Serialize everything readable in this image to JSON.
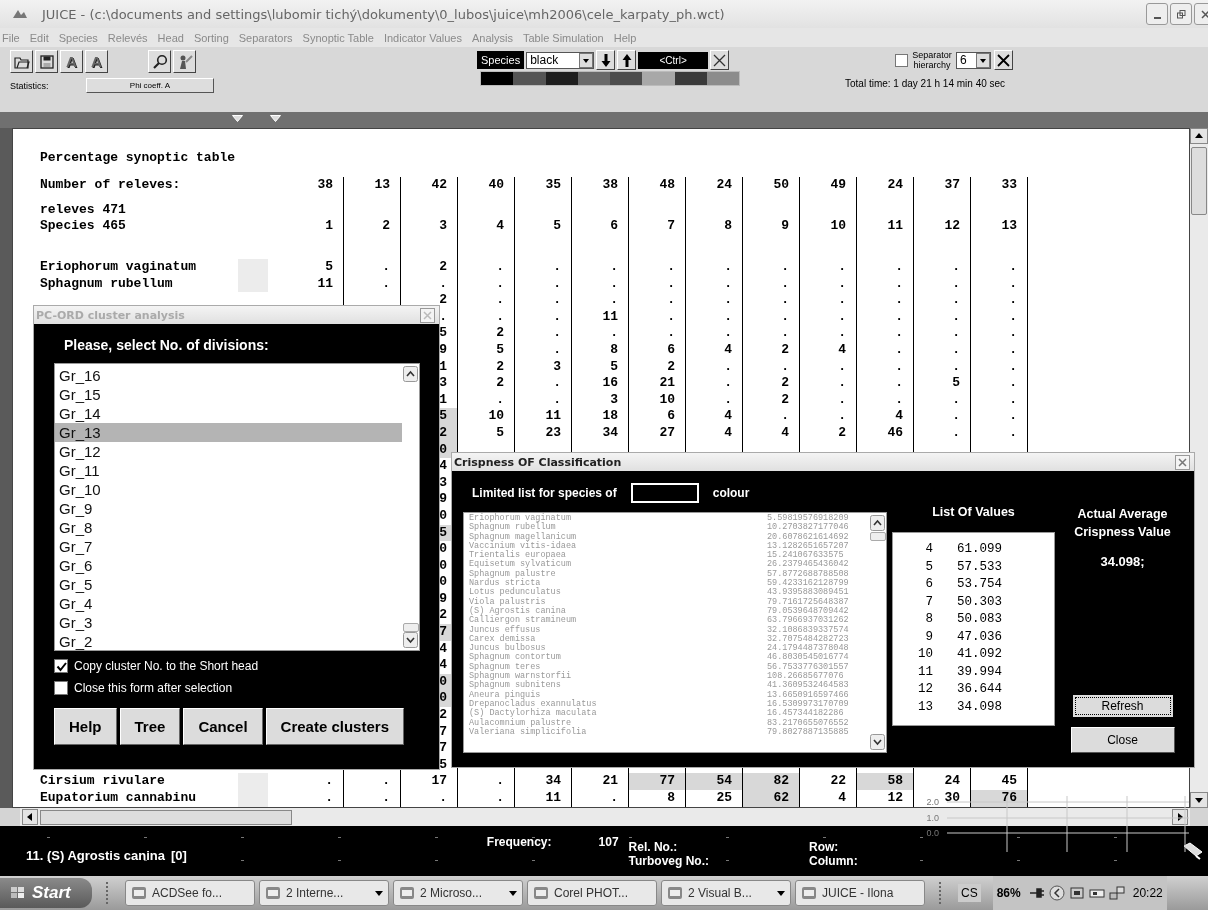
{
  "window": {
    "title": "JUICE - (c:\\documents and settings\\lubomir tichý\\dokumenty\\0_lubos\\juice\\mh2006\\cele_karpaty_ph.wct)"
  },
  "menu": [
    "File",
    "Edit",
    "Species",
    "Relevés",
    "Head",
    "Sorting",
    "Separators",
    "Synoptic Table",
    "Indicator Values",
    "Analysis",
    "Table Simulation",
    "Help"
  ],
  "toolbar": {
    "font_buttons": [
      "A",
      "A"
    ],
    "statistics_label": "Statistics:",
    "statistics_button": "Phi coeff. A",
    "species_label": "Species",
    "species_color": "black",
    "ctrl_label": "<Ctrl>",
    "swatches": [
      {
        "color": "#000000"
      },
      {
        "color": "#555555"
      },
      {
        "color": "#1e1e1e"
      },
      {
        "color": "#6a6a6a"
      },
      {
        "color": "#4c4c4c"
      },
      {
        "color": "#a8a8a8"
      },
      {
        "color": "#3a3a3a"
      },
      {
        "color": "#8c8c8c"
      }
    ],
    "separator_hierarchy": {
      "label": "Separator hierarchy",
      "checked": false,
      "value": "6"
    },
    "total_time": "Total time: 1 day 21 h 14 min 40 sec"
  },
  "table": {
    "title": "Percentage synoptic table",
    "count_label": "Number of releves:",
    "counts": [
      "38",
      "13",
      "42",
      "40",
      "35",
      "38",
      "48",
      "24",
      "50",
      "49",
      "24",
      "37",
      "33"
    ],
    "releves_label": "releves 471",
    "species_label": "Species 465",
    "columns": [
      "1",
      "2",
      "3",
      "4",
      "5",
      "6",
      "7",
      "8",
      "9",
      "10",
      "11",
      "12",
      "13"
    ],
    "rows": [
      {
        "name": "Eriophorum vaginatum",
        "values": {
          "column_1": "5",
          "column_2": ".",
          "column_3": "2",
          "column_4": ".",
          "column_5": ".",
          "column_6": ".",
          "column_7": ".",
          "column_8": ".",
          "column_9": ".",
          "column_10": ".",
          "column_11": ".",
          "column_12": ".",
          "column_13": "."
        }
      },
      {
        "name": "Sphagnum rubellum",
        "values": {
          "column_1": "11",
          "column_2": ".",
          "column_3": ".",
          "column_4": ".",
          "column_5": ".",
          "column_6": ".",
          "column_7": ".",
          "column_8": ".",
          "column_9": ".",
          "column_10": ".",
          "column_11": ".",
          "column_12": ".",
          "column_13": "."
        }
      },
      {
        "values": {
          "column_3": "2",
          "column_4": ".",
          "column_5": ".",
          "column_6": ".",
          "column_7": ".",
          "column_8": ".",
          "column_9": ".",
          "column_10": ".",
          "column_11": ".",
          "column_12": ".",
          "column_13": "."
        }
      },
      {
        "values": {
          "column_3": ".",
          "column_4": ".",
          "column_5": ".",
          "column_6": "11",
          "column_7": ".",
          "column_8": ".",
          "column_9": ".",
          "column_10": ".",
          "column_11": ".",
          "column_12": ".",
          "column_13": "."
        }
      },
      {
        "values": {
          "column_3": "5",
          "column_4": "2",
          "column_5": ".",
          "column_6": ".",
          "column_7": ".",
          "column_8": ".",
          "column_9": ".",
          "column_10": ".",
          "column_11": ".",
          "column_12": ".",
          "column_13": "."
        }
      },
      {
        "values": {
          "column_3": "9",
          "column_4": "5",
          "column_5": ".",
          "column_6": "8",
          "column_7": "6",
          "column_8": "4",
          "column_9": "2",
          "column_10": "4",
          "column_11": ".",
          "column_12": ".",
          "column_13": "."
        }
      },
      {
        "values": {
          "column_3": "1",
          "column_4": "2",
          "column_5": "3",
          "column_6": "5",
          "column_7": "2",
          "column_8": ".",
          "column_9": ".",
          "column_10": ".",
          "column_11": ".",
          "column_12": ".",
          "column_13": "."
        }
      },
      {
        "values": {
          "column_3": "3",
          "column_4": "2",
          "column_5": ".",
          "column_6": "16",
          "column_7": "21",
          "column_8": ".",
          "column_9": "2",
          "column_10": ".",
          "column_11": ".",
          "column_12": "5",
          "column_13": "."
        }
      },
      {
        "values": {
          "column_3": "1",
          "column_4": ".",
          "column_5": ".",
          "column_6": "3",
          "column_7": "10",
          "column_8": ".",
          "column_9": "2",
          "column_10": ".",
          "column_11": ".",
          "column_12": ".",
          "column_13": "."
        }
      },
      {
        "values": {
          "column_3": {
            "text": "5",
            "highlighted": true
          },
          "column_4": "10",
          "column_5": "11",
          "column_6": "18",
          "column_7": "6",
          "column_8": "4",
          "column_9": ".",
          "column_10": ".",
          "column_11": "4",
          "column_12": ".",
          "column_13": "."
        }
      },
      {
        "values": {
          "column_3": {
            "text": "2",
            "highlighted": true
          },
          "column_4": "5",
          "column_5": "23",
          "column_6": "34",
          "column_7": "27",
          "column_8": "4",
          "column_9": "4",
          "column_10": "2",
          "column_11": "46",
          "column_12": ".",
          "column_13": "."
        }
      },
      {
        "values": {
          "column_3": {
            "text": "0",
            "highlighted": true
          }
        }
      },
      {
        "values": {
          "column_3": "4"
        }
      },
      {
        "values": {
          "column_3": "3"
        }
      },
      {
        "values": {
          "column_3": "9"
        }
      },
      {
        "values": {
          "column_3": "0"
        }
      },
      {
        "values": {
          "column_3": {
            "text": "5",
            "highlighted": true
          }
        }
      },
      {
        "values": {
          "column_3": "0"
        }
      },
      {
        "values": {
          "column_3": "0"
        }
      },
      {
        "values": {
          "column_3": "0"
        }
      },
      {
        "values": {
          "column_3": "9"
        }
      },
      {
        "values": {
          "column_3": "2"
        }
      },
      {
        "values": {
          "column_3": {
            "text": "7",
            "highlighted": true
          }
        }
      },
      {
        "values": {
          "column_3": "4"
        }
      },
      {
        "values": {
          "column_3": "4"
        }
      },
      {
        "values": {
          "column_3": {
            "text": "0",
            "highlighted": true
          }
        }
      },
      {
        "values": {
          "column_3": {
            "text": "0",
            "highlighted": true
          }
        }
      },
      {
        "values": {
          "column_3": "2"
        }
      },
      {
        "values": {
          "column_3": "7"
        }
      },
      {
        "values": {
          "column_3": "7"
        }
      },
      {
        "values": {
          "column_3": "5"
        }
      },
      {
        "name": "Cirsium rivulare",
        "values": {
          "column_1": ".",
          "column_2": ".",
          "column_3": "17",
          "column_4": ".",
          "column_5": "34",
          "column_6": "21",
          "column_7": {
            "text": "77",
            "highlighted": true
          },
          "column_8": {
            "text": "54",
            "highlighted": true
          },
          "column_9": {
            "text": "82",
            "highlighted": true
          },
          "column_10": "22",
          "column_11": {
            "text": "58",
            "highlighted": true
          },
          "column_12": "24",
          "column_13": "45"
        }
      },
      {
        "name": "Eupatorium cannabinu",
        "values": {
          "column_1": ".",
          "column_2": ".",
          "column_3": ".",
          "column_4": ".",
          "column_5": "11",
          "column_6": ".",
          "column_7": "8",
          "column_8": "25",
          "column_9": {
            "text": "62",
            "highlighted": true
          },
          "column_10": "4",
          "column_11": "12",
          "column_12": "30",
          "column_13": {
            "text": "76",
            "highlighted": true
          }
        }
      }
    ]
  },
  "overlay_chart": {
    "ticks": [
      "2.0",
      "1.0",
      "0.0"
    ]
  },
  "cluster_dialog": {
    "title": "PC-ORD cluster analysis",
    "prompt": "Please, select No. of divisions:",
    "items": [
      {
        "label": "Gr_16",
        "selected": false
      },
      {
        "label": "Gr_15",
        "selected": false
      },
      {
        "label": "Gr_14",
        "selected": false
      },
      {
        "label": "Gr_13",
        "selected": true
      },
      {
        "label": "Gr_12",
        "selected": false
      },
      {
        "label": "Gr_11",
        "selected": false
      },
      {
        "label": "Gr_10",
        "selected": false
      },
      {
        "label": "Gr_9",
        "selected": false
      },
      {
        "label": "Gr_8",
        "selected": false
      },
      {
        "label": "Gr_7",
        "selected": false
      },
      {
        "label": "Gr_6",
        "selected": false
      },
      {
        "label": "Gr_5",
        "selected": false
      },
      {
        "label": "Gr_4",
        "selected": false
      },
      {
        "label": "Gr_3",
        "selected": false
      },
      {
        "label": "Gr_2",
        "selected": false
      }
    ],
    "options": [
      {
        "label": "Copy cluster No. to the Short head",
        "checked": true
      },
      {
        "label": "Close this form after selection",
        "checked": false
      }
    ],
    "buttons": [
      "Help",
      "Tree",
      "Cancel",
      "Create clusters"
    ]
  },
  "crispness_dialog": {
    "title": "Crispness OF Classification",
    "limited_label": "Limited list for species of",
    "colour_label": "colour",
    "species": [
      {
        "name": "Eriophorum vaginatum",
        "value": "5.59819576918209"
      },
      {
        "name": "Sphagnum rubellum",
        "value": "10.2703827177046"
      },
      {
        "name": "Sphagnum magellanicum",
        "value": "20.6078621614692"
      },
      {
        "name": "Vaccinium vitis-idaea",
        "value": "13.1282651657207"
      },
      {
        "name": "Trientalis europaea",
        "value": "15.241067633575"
      },
      {
        "name": "Equisetum sylvaticum",
        "value": "26.2379465436042"
      },
      {
        "name": "Sphagnum palustre",
        "value": "57.8772688788508"
      },
      {
        "name": "Nardus stricta",
        "value": "59.4233162128799"
      },
      {
        "name": "Lotus pedunculatus",
        "value": "43.9395883089451"
      },
      {
        "name": "Viola palustris",
        "value": "79.7161725648387"
      },
      {
        "name": "(S) Agrostis canina",
        "value": "79.0539648709442"
      },
      {
        "name": "Calliergon stramineum",
        "value": "63.7966937031262"
      },
      {
        "name": "Juncus effusus",
        "value": "32.1086839337574"
      },
      {
        "name": "Carex demissa",
        "value": "32.7075484282723"
      },
      {
        "name": "Juncus bulbosus",
        "value": "24.1794487378048"
      },
      {
        "name": "Sphagnum contortum",
        "value": "46.8030545016774"
      },
      {
        "name": "Sphagnum teres",
        "value": "56.7533776301557"
      },
      {
        "name": "Sphagnum warnstorfii",
        "value": "108.26685677076"
      },
      {
        "name": "Sphagnum subnitens",
        "value": "41.3609532464583"
      },
      {
        "name": "Aneura pinguis",
        "value": "13.6650916597466"
      },
      {
        "name": "Drepanocladus exannulatus",
        "value": "16.5309973170709"
      },
      {
        "name": "(S) Dactylorhiza maculata",
        "value": "16.457344182286"
      },
      {
        "name": "Aulacomnium palustre",
        "value": "83.2170655076552"
      },
      {
        "name": "Valeriana simplicifolia",
        "value": "79.8027887135885"
      }
    ],
    "values_header": "List Of Values",
    "values": [
      {
        "number": "4",
        "value": "61.099"
      },
      {
        "number": "5",
        "value": "57.533"
      },
      {
        "number": "6",
        "value": "53.754"
      },
      {
        "number": "7",
        "value": "50.303"
      },
      {
        "number": "8",
        "value": "50.083"
      },
      {
        "number": "9",
        "value": "47.036"
      },
      {
        "number": "10",
        "value": "41.092"
      },
      {
        "number": "11",
        "value": "39.994"
      },
      {
        "number": "12",
        "value": "36.644"
      },
      {
        "number": "13",
        "value": "34.098"
      }
    ],
    "average_header": "Actual Average Crispness Value",
    "average": "34.098;",
    "buttons": [
      {
        "label": "Refresh",
        "focused": true
      },
      {
        "label": "Close",
        "focused": false
      }
    ]
  },
  "status_bar": {
    "species": "11. (S) Agrostis canina",
    "count": "[0]",
    "frequency_label": "Frequency:",
    "frequency": "107",
    "rel_no_label": "Rel. No.:",
    "turboveg_label": "Turboveg No.:",
    "row_label": "Row:",
    "column_label": "Column:"
  },
  "taskbar": {
    "start": "Start",
    "tasks": [
      {
        "label": "ACDSee fo...",
        "grouped": false
      },
      {
        "label": "2 Interne...",
        "grouped": true
      },
      {
        "label": "2 Microso...",
        "grouped": true
      },
      {
        "label": "Corel PHOT...",
        "grouped": false
      },
      {
        "label": "2 Visual B...",
        "grouped": true
      },
      {
        "label": "JUICE - Ilona",
        "grouped": false
      }
    ],
    "language": "CS",
    "battery": "86%",
    "clock": "20:22"
  }
}
